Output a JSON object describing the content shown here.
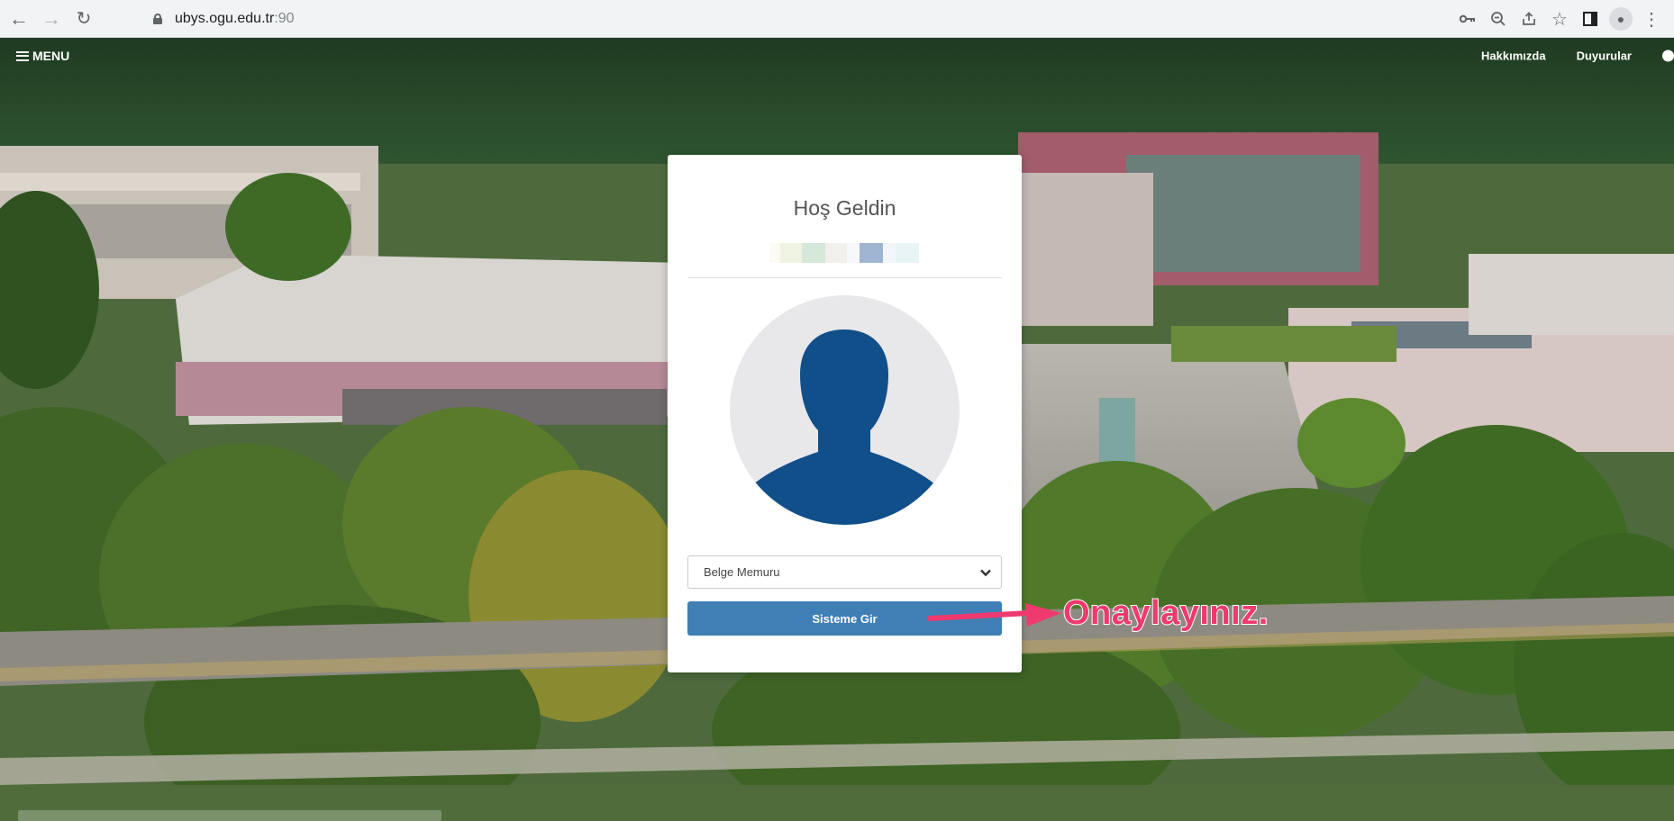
{
  "browser": {
    "url_host": "ubys.ogu.edu.tr",
    "url_port": ":90",
    "icons": [
      "back-arrow-icon",
      "forward-arrow-icon",
      "reload-icon",
      "lock-icon",
      "key-icon",
      "zoom-icon",
      "share-icon",
      "star-icon",
      "sidebar-icon",
      "profile-icon",
      "more-vert-icon"
    ]
  },
  "topbar": {
    "menu_label": "MENU",
    "links": [
      "Hakkımızda",
      "Duyurular"
    ]
  },
  "card": {
    "title": "Hoş Geldin",
    "role_select_value": "Belge Memuru",
    "submit_label": "Sisteme Gir"
  },
  "annotation": {
    "text": "Onaylayınız.",
    "color": "#ee3a6e"
  },
  "colors": {
    "primary_button": "#3f7fb5",
    "avatar_silhouette": "#114f8a"
  }
}
